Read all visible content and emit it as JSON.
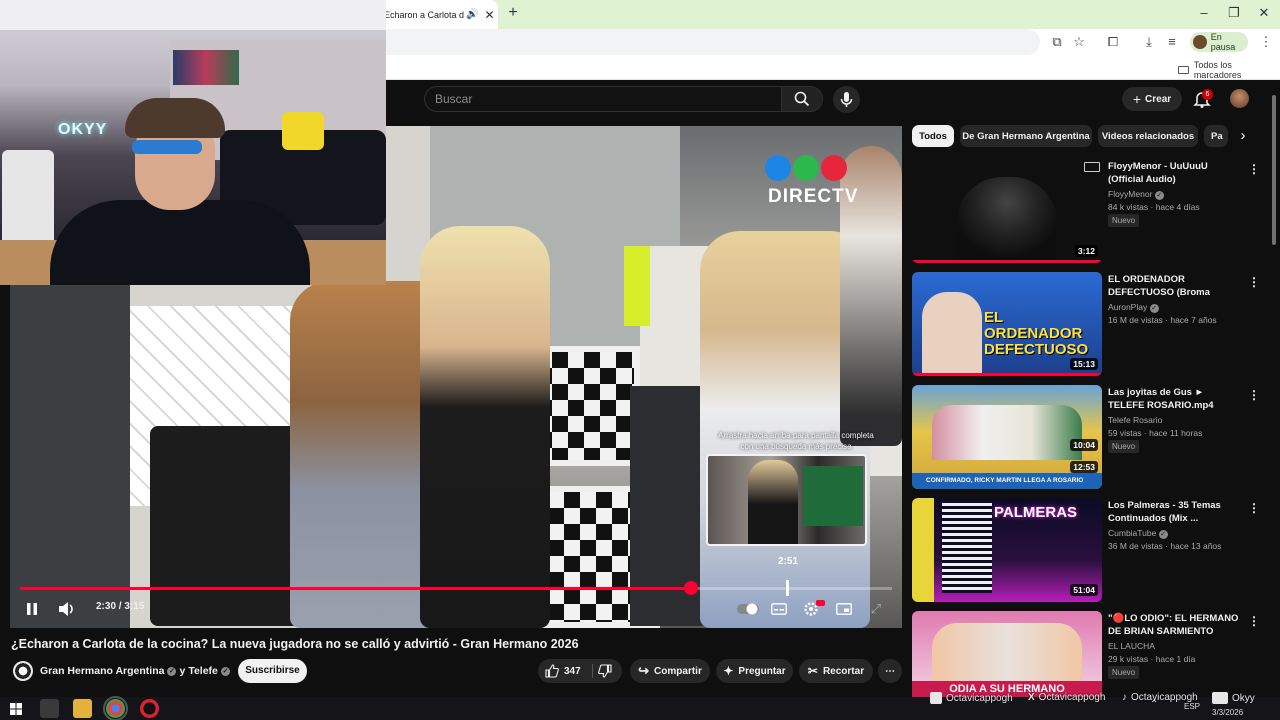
{
  "browser": {
    "tab_title": "Echaron a Carlota de la",
    "profile_status": "En pausa",
    "bookmarks_all": "Todos los marcadores"
  },
  "masthead": {
    "search_placeholder": "Buscar",
    "create_label": "Crear",
    "notifications_count": "6"
  },
  "webcam": {
    "neon_sign": "OKYY"
  },
  "player": {
    "watermark_brand": "DIRECTV",
    "watermark_colors": [
      "#1c86e8",
      "#2db84d",
      "#e6263a"
    ],
    "swipe_hint": "Arrastra hacia arriba para pantalla completa con una búsqueda más precisa",
    "preview_time": "2:51",
    "current_time": "2:30",
    "duration": "3:15",
    "progress_fraction": 0.769,
    "hover_fraction": 0.88,
    "accent": "#ff0033"
  },
  "video": {
    "title": "¿Echaron a Carlota de la cocina? La nueva jugadora no se calló y advirtió - Gran Hermano 2026",
    "channel": "Gran Hermano Argentina",
    "channel_join": "y",
    "channel_second": "Telefe",
    "subscribe_label": "Suscribirse",
    "likes": "347",
    "share_label": "Compartir",
    "ask_label": "Preguntar",
    "clip_label": "Recortar"
  },
  "chips": [
    "Todos",
    "De Gran Hermano Argentina",
    "Videos relacionados",
    "Pa"
  ],
  "recommendations": [
    {
      "title": "FloyyMenor - UuUuuU (Official Audio)",
      "channel": "FloyyMenor",
      "meta": "84 k vistas · hace 4 días",
      "badge": "Nuevo",
      "duration": "3:12",
      "thumb_colors": [
        "#1b1b1b",
        "#3a3a3a"
      ]
    },
    {
      "title": "EL ORDENADOR DEFECTUOSO (Broma telefónica)",
      "channel": "AuronPlay",
      "meta": "16 M de vistas · hace 7 años",
      "badge": "",
      "duration": "15:13",
      "thumb_text": "EL ORDENADOR DEFECTUOSO",
      "thumb_colors": [
        "#2a6fd6",
        "#e6e6e6"
      ]
    },
    {
      "title": "Las joyitas de Gus ► TELEFE ROSARIO.mp4",
      "channel": "Telefe Rosario",
      "meta": "59 vistas · hace 11 horas",
      "badge": "Nuevo",
      "duration": "12:53",
      "thumb_hover_time": "10:04",
      "thumb_caption": "CONFIRMADO, RICKY MARTIN LLEGA A ROSARIO",
      "thumb_colors": [
        "#d5c24a",
        "#5a8cc4"
      ]
    },
    {
      "title": "Los Palmeras - 35 Temas Continuados (Mix ...",
      "channel": "CumbiaTube",
      "meta": "36 M de vistas · hace 13 años",
      "badge": "",
      "duration": "51:04",
      "thumb_text": "PALMERAS",
      "thumb_colors": [
        "#0b0b24",
        "#b51fb8"
      ]
    },
    {
      "title": "\"🔴LO ODIO\": EL HERMANO DE BRIAN SARMIENTO furioso ...",
      "channel": "EL LAUCHA",
      "meta": "29 k vistas · hace 1 día",
      "badge": "Nuevo",
      "duration": "",
      "thumb_text": "ODIA A SU HERMANO",
      "thumb_colors": [
        "#d94da0",
        "#f2d3e4"
      ]
    }
  ],
  "overlay_socials": [
    "Octavicappogh",
    "Octavicappogh",
    "Octavicappogh",
    "Okyy"
  ],
  "taskbar": {
    "lang": "ESP",
    "date": "3/3/2026"
  }
}
